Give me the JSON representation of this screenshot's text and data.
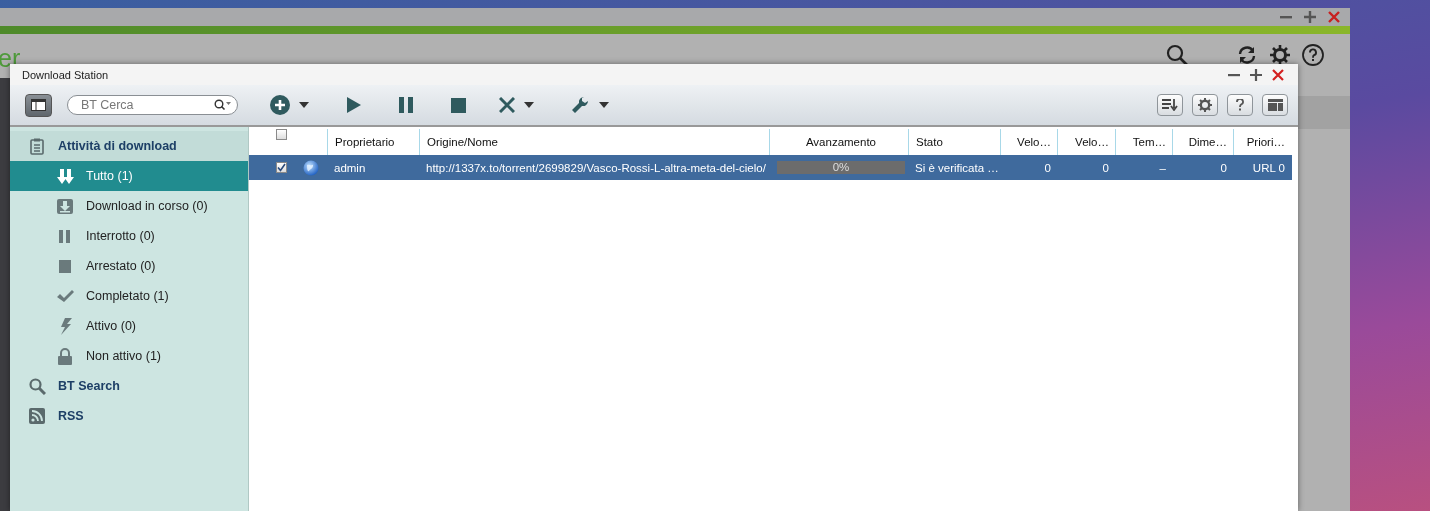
{
  "background_app": {
    "title_fragment": "er"
  },
  "window": {
    "title": "Download Station"
  },
  "toolbar": {
    "search": {
      "placeholder": "BT Cerca"
    }
  },
  "sidebar": {
    "items": [
      {
        "label": "Attività di download",
        "kind": "tasks",
        "selected": false,
        "children": [
          {
            "label": "Tutto (1)",
            "kind": "all",
            "selected": true
          },
          {
            "label": "Download in corso (0)",
            "kind": "downloading",
            "selected": false
          },
          {
            "label": "Interrotto (0)",
            "kind": "paused",
            "selected": false
          },
          {
            "label": "Arrestato (0)",
            "kind": "stopped",
            "selected": false
          },
          {
            "label": "Completato (1)",
            "kind": "completed",
            "selected": false
          },
          {
            "label": "Attivo (0)",
            "kind": "active",
            "selected": false
          },
          {
            "label": "Non attivo (1)",
            "kind": "inactive",
            "selected": false
          }
        ]
      },
      {
        "label": "BT Search",
        "kind": "search",
        "selected": false
      },
      {
        "label": "RSS",
        "kind": "rss",
        "selected": false
      }
    ]
  },
  "table": {
    "header_checked": false,
    "columns": [
      "Proprietario",
      "Origine/Nome",
      "Avanzamento",
      "Stato",
      "Velo…",
      "Velo…",
      "Tem…",
      "Dime…",
      "Priori…"
    ],
    "rows": [
      {
        "selected": true,
        "checked": true,
        "owner": "admin",
        "source": "http://1337x.to/torrent/2699829/Vasco-Rossi-L-altra-meta-del-cielo/",
        "progress": {
          "level": 0,
          "reading": "0%"
        },
        "status": "Si è verificata …",
        "values": [
          "0",
          "0",
          "–",
          "0",
          "URL 0"
        ]
      }
    ]
  }
}
